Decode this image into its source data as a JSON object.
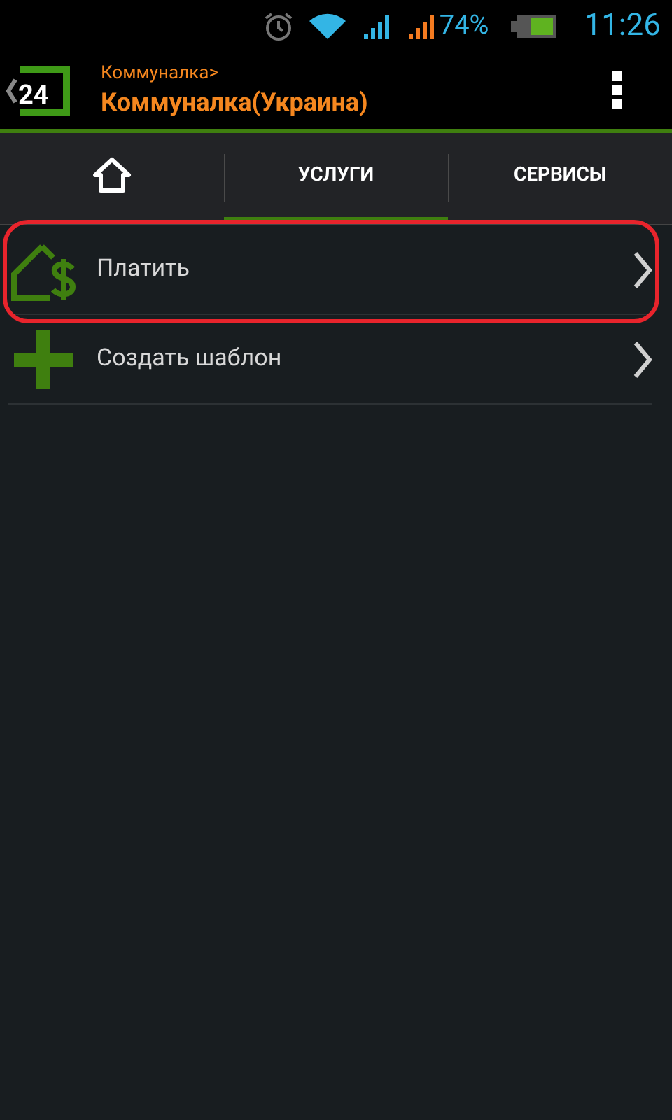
{
  "status_bar": {
    "battery_percent": "74%",
    "time": "11:26"
  },
  "header": {
    "breadcrumb": "Коммуналка>",
    "title": "Коммуналка(Украина)",
    "logo_text": "24"
  },
  "tabs": [
    {
      "kind": "home",
      "selected": false
    },
    {
      "kind": "text",
      "label": "УСЛУГИ",
      "selected": true
    },
    {
      "kind": "text",
      "label": "СЕРВИСЫ",
      "selected": false
    }
  ],
  "items": [
    {
      "kind": "pay",
      "label": "Платить",
      "highlighted": true
    },
    {
      "kind": "add",
      "label": "Создать шаблон",
      "highlighted": false
    }
  ]
}
